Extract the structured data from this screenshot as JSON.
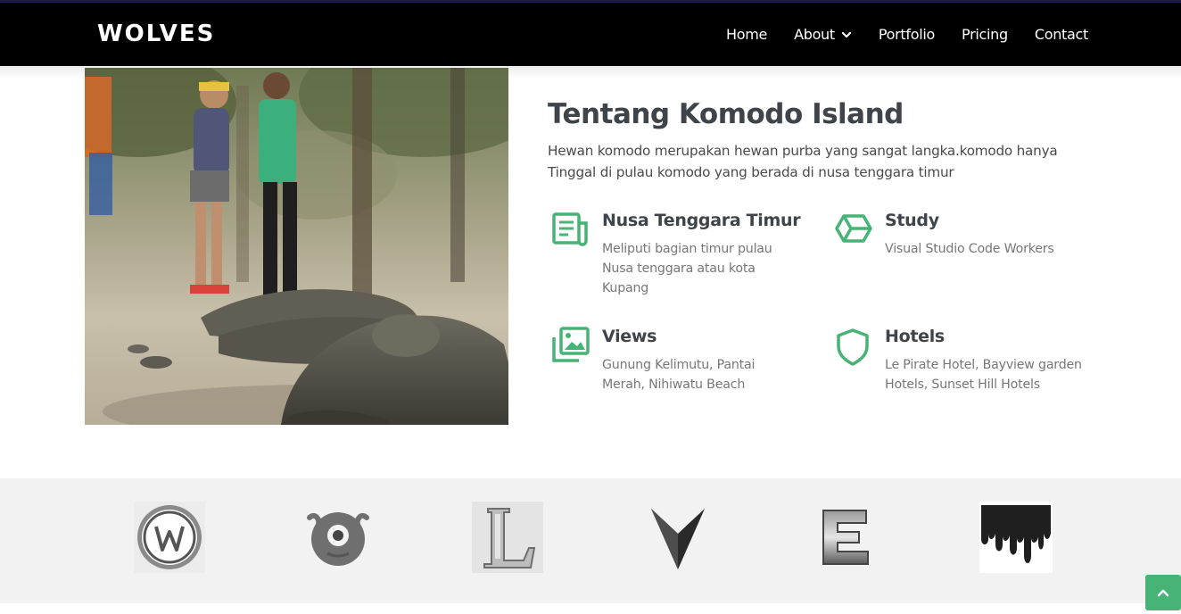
{
  "header": {
    "logo": "WOLVES",
    "nav": [
      {
        "label": "Home"
      },
      {
        "label": "About"
      },
      {
        "label": "Portfolio"
      },
      {
        "label": "Pricing"
      },
      {
        "label": "Contact"
      }
    ]
  },
  "about": {
    "title": "Tentang Komodo Island",
    "description": "Hewan komodo merupakan hewan purba yang sangat langka.komodo hanya Tinggal di pulau komodo yang berada di nusa tenggara timur",
    "features": [
      {
        "icon": "newspaper-icon",
        "title": "Nusa Tenggara Timur",
        "text": "Meliputi bagian timur pulau Nusa tenggara atau kota Kupang"
      },
      {
        "icon": "cube-icon",
        "title": "Study",
        "text": "Visual Studio Code Workers"
      },
      {
        "icon": "images-icon",
        "title": "Views",
        "text": "Gunung Kelimutu, Pantai Merah, Nihiwatu Beach"
      },
      {
        "icon": "shield-icon",
        "title": "Hotels",
        "text": "Le Pirate Hotel, Bayview garden Hotels, Sunset Hill Hotels"
      }
    ]
  },
  "clients": [
    {
      "icon": "letter-w-logo-icon"
    },
    {
      "icon": "monster-logo-icon"
    },
    {
      "icon": "letter-l-logo-icon"
    },
    {
      "icon": "letter-v-logo-icon"
    },
    {
      "icon": "letter-e-logo-icon"
    },
    {
      "icon": "paint-drip-logo-icon"
    }
  ],
  "colors": {
    "accent": "#47b475",
    "header_bg": "#000000",
    "clients_bg": "#f2f2f2"
  }
}
